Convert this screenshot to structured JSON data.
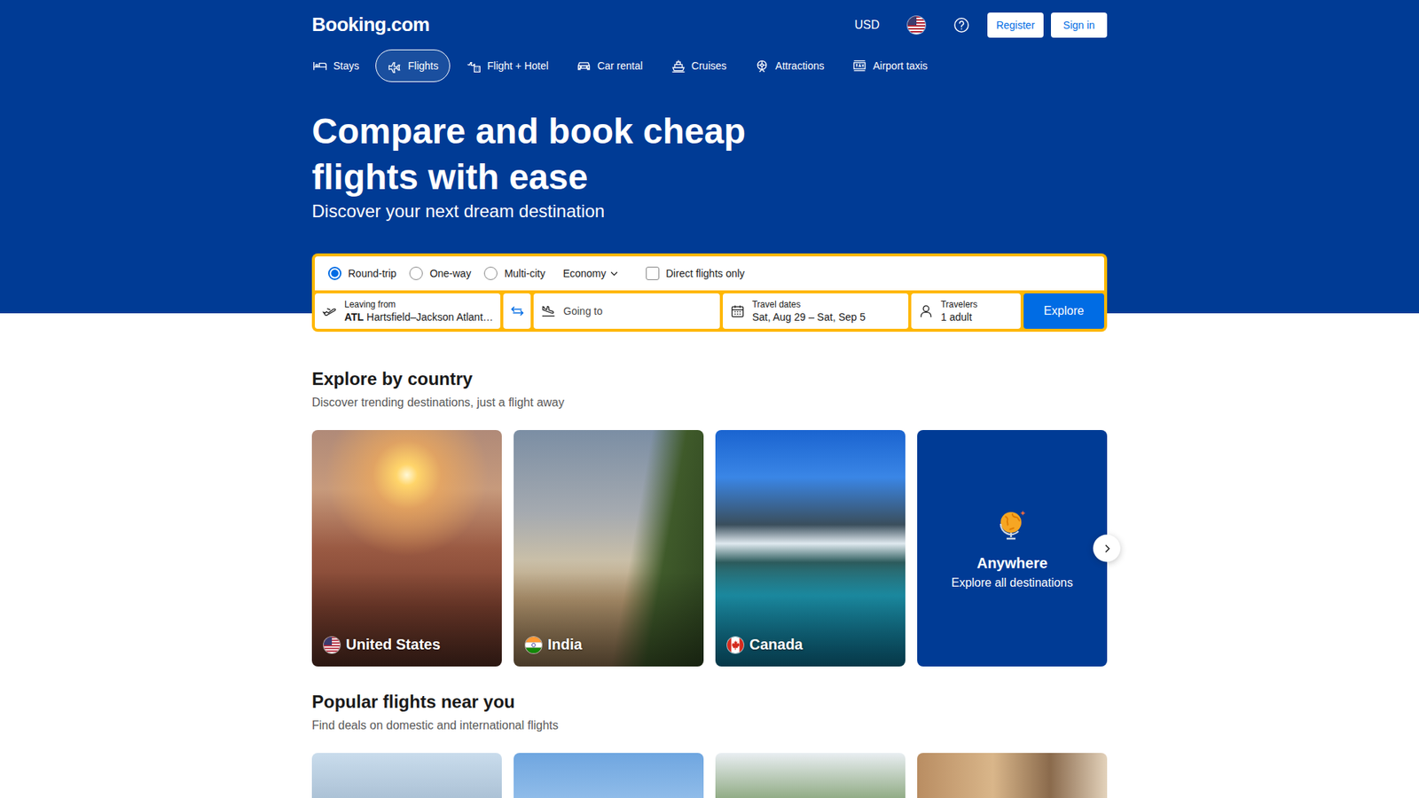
{
  "header": {
    "logo": "Booking.com",
    "currency": "USD",
    "register": "Register",
    "sign_in": "Sign in"
  },
  "nav": [
    {
      "label": "Stays",
      "selected": false
    },
    {
      "label": "Flights",
      "selected": true
    },
    {
      "label": "Flight + Hotel",
      "selected": false
    },
    {
      "label": "Car rental",
      "selected": false
    },
    {
      "label": "Cruises",
      "selected": false
    },
    {
      "label": "Attractions",
      "selected": false
    },
    {
      "label": "Airport taxis",
      "selected": false
    }
  ],
  "hero": {
    "title": "Compare and book cheap flights with ease",
    "subtitle": "Discover your next dream destination"
  },
  "search": {
    "trip_types": [
      {
        "label": "Round-trip",
        "selected": true
      },
      {
        "label": "One-way",
        "selected": false
      },
      {
        "label": "Multi-city",
        "selected": false
      }
    ],
    "cabin": "Economy",
    "direct_only": {
      "label": "Direct flights only",
      "checked": false
    },
    "leaving_from": {
      "label": "Leaving from",
      "code": "ATL",
      "value": "Hartsfield–Jackson Atlant…"
    },
    "going_to": {
      "placeholder": "Going to"
    },
    "dates": {
      "label": "Travel dates",
      "value": "Sat, Aug 29 – Sat, Sep 5"
    },
    "travelers": {
      "label": "Travelers",
      "value": "1 adult"
    },
    "button": "Explore"
  },
  "explore_by_country": {
    "title": "Explore by country",
    "subtitle": "Discover trending destinations, just a flight away",
    "countries": [
      {
        "name": "United States"
      },
      {
        "name": "India"
      },
      {
        "name": "Canada"
      }
    ],
    "anywhere": {
      "title": "Anywhere",
      "subtitle": "Explore all destinations"
    }
  },
  "popular_flights": {
    "title": "Popular flights near you",
    "subtitle": "Find deals on domestic and international flights"
  }
}
